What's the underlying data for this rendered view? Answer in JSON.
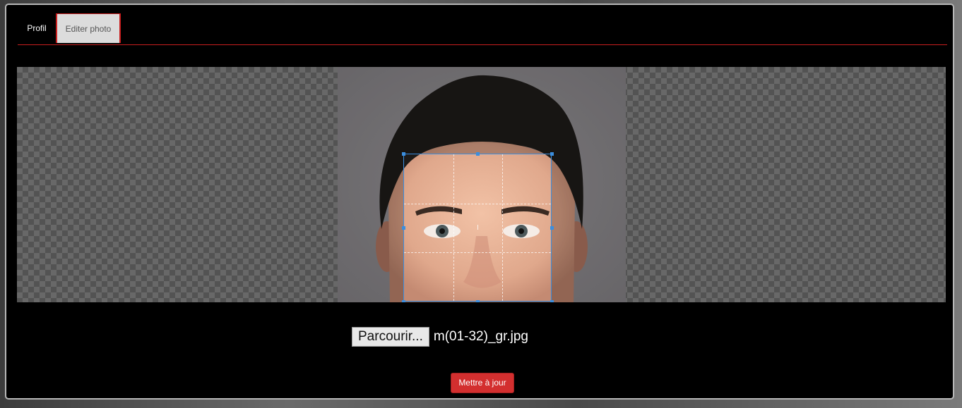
{
  "tabs": {
    "profil_label": "Profil",
    "editer_label": "Editer photo",
    "active": "Editer photo"
  },
  "cropper": {
    "photo_description_icon": "portrait-photo",
    "guides": "3x3 dashed"
  },
  "file_input": {
    "button_label": "Parcourir...",
    "file_name": "m(01-32)_gr.jpg"
  },
  "actions": {
    "update_label": "Mettre à jour"
  },
  "colors": {
    "accent": "#c81e1e",
    "button_red": "#d32f2f",
    "crop_border": "#3b8ede",
    "background": "#000000"
  }
}
